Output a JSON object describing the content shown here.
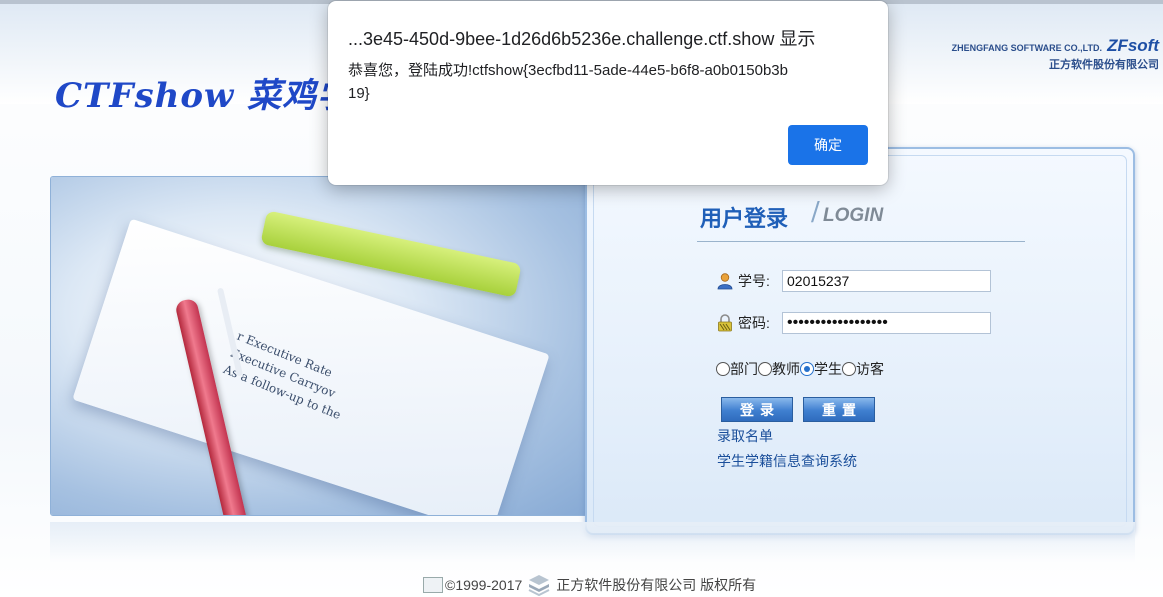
{
  "header": {
    "site_logo": "CTFshow 菜鸡学",
    "brand_en": "ZHENGFANG SOFTWARE CO.,LTD.",
    "brand_logo": "ZFsoft",
    "brand_cn": "正方软件股份有限公司"
  },
  "login": {
    "title": "用户登录",
    "subtitle": "LOGIN",
    "username_label": "学号:",
    "username_value": "02015237",
    "password_label": "密码:",
    "password_value": "••••••••••••••••••",
    "roles": [
      {
        "label": "部门",
        "selected": false
      },
      {
        "label": "教师",
        "selected": false
      },
      {
        "label": "学生",
        "selected": true
      },
      {
        "label": "访客",
        "selected": false
      }
    ],
    "login_button": "登录",
    "reset_button": "重置",
    "link_admission": "录取名单",
    "link_status_query": "学生学籍信息查询系统"
  },
  "banner_text": {
    "line1": "r Executive Rate",
    "line2": "Executive Carryov",
    "line3": "As a follow-up to the"
  },
  "footer": {
    "copyright": "©1999-2017",
    "company": "正方软件股份有限公司 版权所有"
  },
  "dialog": {
    "title": "...3e45-450d-9bee-1d26d6b5236e.challenge.ctf.show 显示",
    "message": "恭喜您，登陆成功!ctfshow{3ecfbd11-5ade-44e5-b6f8-a0b0150b3b19}",
    "ok_button": "确定"
  },
  "colors": {
    "accent": "#1a73e8",
    "login_title": "#1f5fb8",
    "button": "#3f7fd0"
  },
  "icons": {
    "username": "user-icon",
    "password": "lock-icon"
  }
}
